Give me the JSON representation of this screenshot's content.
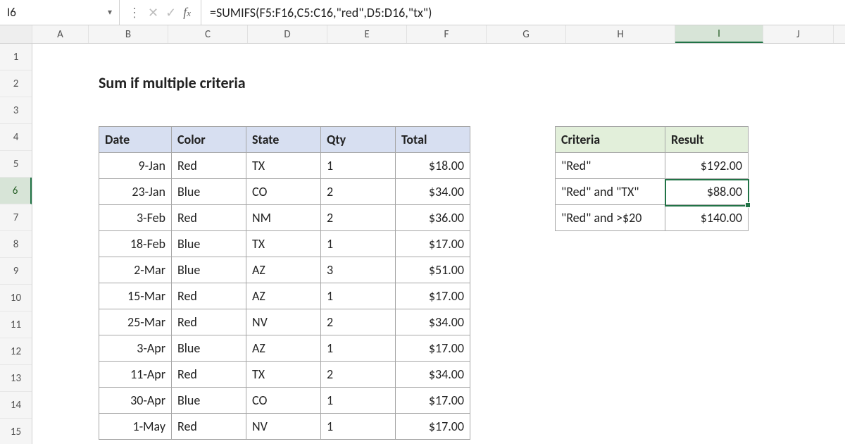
{
  "namebox": {
    "value": "I6"
  },
  "formula": "=SUMIFS(F5:F16,C5:C16,\"red\",D5:D16,\"tx\")",
  "columns": [
    "A",
    "B",
    "C",
    "D",
    "E",
    "F",
    "G",
    "H",
    "I",
    "J"
  ],
  "rows": [
    "1",
    "2",
    "3",
    "4",
    "5",
    "6",
    "7",
    "8",
    "9",
    "10",
    "11",
    "12",
    "13",
    "14",
    "15"
  ],
  "active_col": "I",
  "active_row": "6",
  "title": "Sum if multiple criteria",
  "table": {
    "headers": {
      "date": "Date",
      "color": "Color",
      "state": "State",
      "qty": "Qty",
      "total": "Total"
    },
    "rows": [
      {
        "date": "9-Jan",
        "color": "Red",
        "state": "TX",
        "qty": "1",
        "total": "$18.00"
      },
      {
        "date": "23-Jan",
        "color": "Blue",
        "state": "CO",
        "qty": "2",
        "total": "$34.00"
      },
      {
        "date": "3-Feb",
        "color": "Red",
        "state": "NM",
        "qty": "2",
        "total": "$36.00"
      },
      {
        "date": "18-Feb",
        "color": "Blue",
        "state": "TX",
        "qty": "1",
        "total": "$17.00"
      },
      {
        "date": "2-Mar",
        "color": "Blue",
        "state": "AZ",
        "qty": "3",
        "total": "$51.00"
      },
      {
        "date": "15-Mar",
        "color": "Red",
        "state": "AZ",
        "qty": "1",
        "total": "$17.00"
      },
      {
        "date": "25-Mar",
        "color": "Red",
        "state": "NV",
        "qty": "2",
        "total": "$34.00"
      },
      {
        "date": "3-Apr",
        "color": "Blue",
        "state": "AZ",
        "qty": "1",
        "total": "$17.00"
      },
      {
        "date": "11-Apr",
        "color": "Red",
        "state": "TX",
        "qty": "2",
        "total": "$34.00"
      },
      {
        "date": "30-Apr",
        "color": "Blue",
        "state": "CO",
        "qty": "1",
        "total": "$17.00"
      },
      {
        "date": "1-May",
        "color": "Red",
        "state": "NV",
        "qty": "1",
        "total": "$17.00"
      }
    ]
  },
  "criteria": {
    "headers": {
      "criteria": "Criteria",
      "result": "Result"
    },
    "rows": [
      {
        "criteria": "\"Red\"",
        "result": "$192.00"
      },
      {
        "criteria": "\"Red\" and \"TX\"",
        "result": "$88.00"
      },
      {
        "criteria": "\"Red\" and >$20",
        "result": "$140.00"
      }
    ]
  },
  "chart_data": {
    "type": "table",
    "title": "Sum if multiple criteria",
    "data_range": {
      "columns": [
        "Date",
        "Color",
        "State",
        "Qty",
        "Total"
      ],
      "rows": [
        [
          "9-Jan",
          "Red",
          "TX",
          1,
          18.0
        ],
        [
          "23-Jan",
          "Blue",
          "CO",
          2,
          34.0
        ],
        [
          "3-Feb",
          "Red",
          "NM",
          2,
          36.0
        ],
        [
          "18-Feb",
          "Blue",
          "TX",
          1,
          17.0
        ],
        [
          "2-Mar",
          "Blue",
          "AZ",
          3,
          51.0
        ],
        [
          "15-Mar",
          "Red",
          "AZ",
          1,
          17.0
        ],
        [
          "25-Mar",
          "Red",
          "NV",
          2,
          34.0
        ],
        [
          "3-Apr",
          "Blue",
          "AZ",
          1,
          17.0
        ],
        [
          "11-Apr",
          "Red",
          "TX",
          2,
          34.0
        ],
        [
          "30-Apr",
          "Blue",
          "CO",
          1,
          17.0
        ],
        [
          "1-May",
          "Red",
          "NV",
          1,
          17.0
        ]
      ]
    },
    "results": [
      {
        "criteria": "\"Red\"",
        "result": 192.0
      },
      {
        "criteria": "\"Red\" and \"TX\"",
        "result": 88.0
      },
      {
        "criteria": "\"Red\" and >$20",
        "result": 140.0
      }
    ],
    "formula_shown": "=SUMIFS(F5:F16,C5:C16,\"red\",D5:D16,\"tx\")",
    "active_cell": "I6"
  }
}
